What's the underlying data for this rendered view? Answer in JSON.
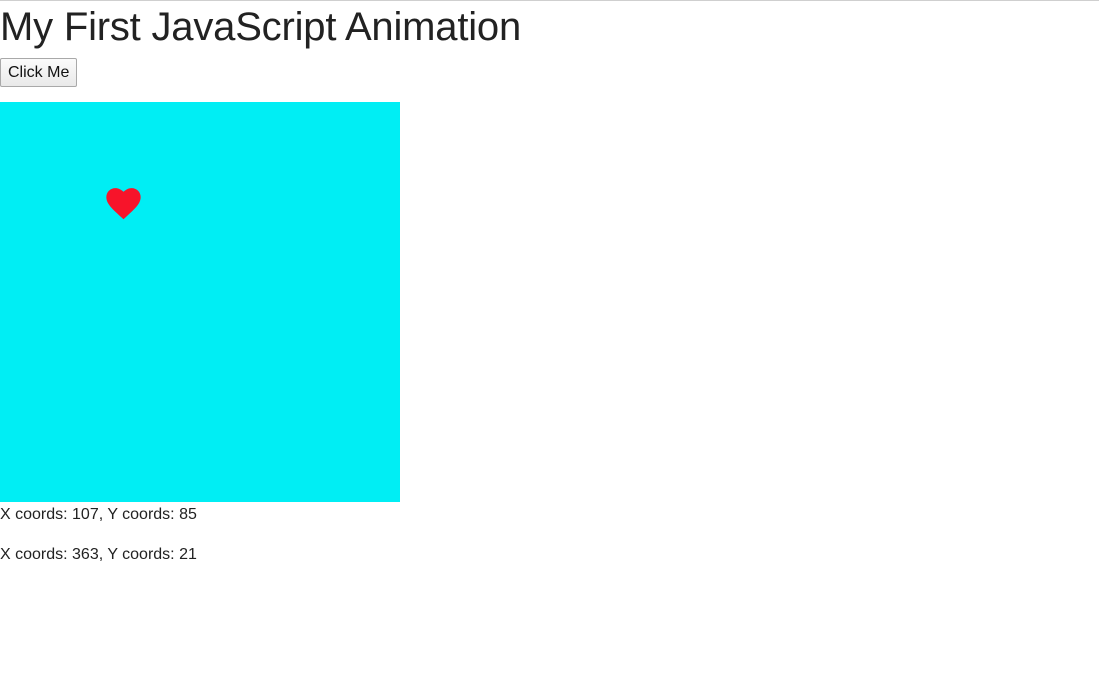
{
  "heading": "My First JavaScript Animation",
  "button": {
    "label": "Click Me"
  },
  "stage": {
    "background_color": "#00eef4",
    "sprite": {
      "icon": "heart-icon",
      "color": "#f7142a"
    }
  },
  "coords": [
    "X coords: 107, Y coords: 85",
    "X coords: 363, Y coords: 21"
  ]
}
